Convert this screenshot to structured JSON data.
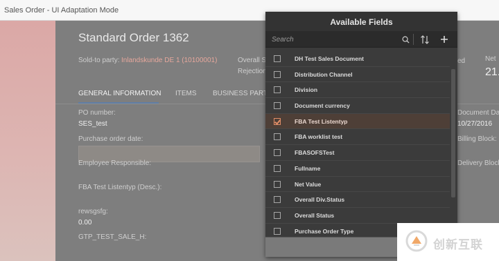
{
  "shell": {
    "title": "Sales Order  - UI Adaptation Mode"
  },
  "header": {
    "title": "Standard Order 1362",
    "sold_to_label": "Sold-to party:",
    "sold_to_value": "Inlandskunde DE 1 (10100001)",
    "overall_label": "Overall S",
    "rejection_label": "Rejection",
    "right_label_1": "ed",
    "right_label_2": "Net",
    "right_value": "21."
  },
  "tabs": [
    {
      "label": "GENERAL INFORMATION",
      "active": true
    },
    {
      "label": "ITEMS",
      "active": false
    },
    {
      "label": "BUSINESS PART",
      "active": false
    }
  ],
  "form": {
    "po_number_label": "PO number:",
    "po_number_value": "SES_test",
    "purchase_order_date_label": "Purchase order date:",
    "employee_label": "Employee Responsible:",
    "fba_label": "FBA Test Listentyp (Desc.):",
    "rewsgsfg_label": "rewsgsfg:",
    "rewsgsfg_value": "0.00",
    "gtp_label": "GTP_TEST_SALE_H:",
    "document_date_label": "Document Dat",
    "document_date_value": "10/27/2016",
    "billing_block_label": "Billing Block:",
    "delivery_block_label": "Delivery Block"
  },
  "popover": {
    "title": "Available Fields",
    "search_placeholder": "Search",
    "fields": [
      {
        "label": "DH Test Sales Document",
        "checked": false
      },
      {
        "label": "Distribution Channel",
        "checked": false
      },
      {
        "label": "Division",
        "checked": false
      },
      {
        "label": "Document currency",
        "checked": false
      },
      {
        "label": "FBA Test Listentyp",
        "checked": true
      },
      {
        "label": "FBA worklist test",
        "checked": false
      },
      {
        "label": "FBASOFSTest",
        "checked": false
      },
      {
        "label": "Fullname",
        "checked": false
      },
      {
        "label": "Net Value",
        "checked": false
      },
      {
        "label": "Overall Div.Status",
        "checked": false
      },
      {
        "label": "Overall Status",
        "checked": false
      },
      {
        "label": "Purchase Order Type",
        "checked": false
      }
    ]
  },
  "watermark": {
    "text": "创新互联"
  },
  "colors": {
    "accent": "#e28e67",
    "popover_bg": "#3b3b3b",
    "tab_indicator": "#5f7ea6"
  }
}
